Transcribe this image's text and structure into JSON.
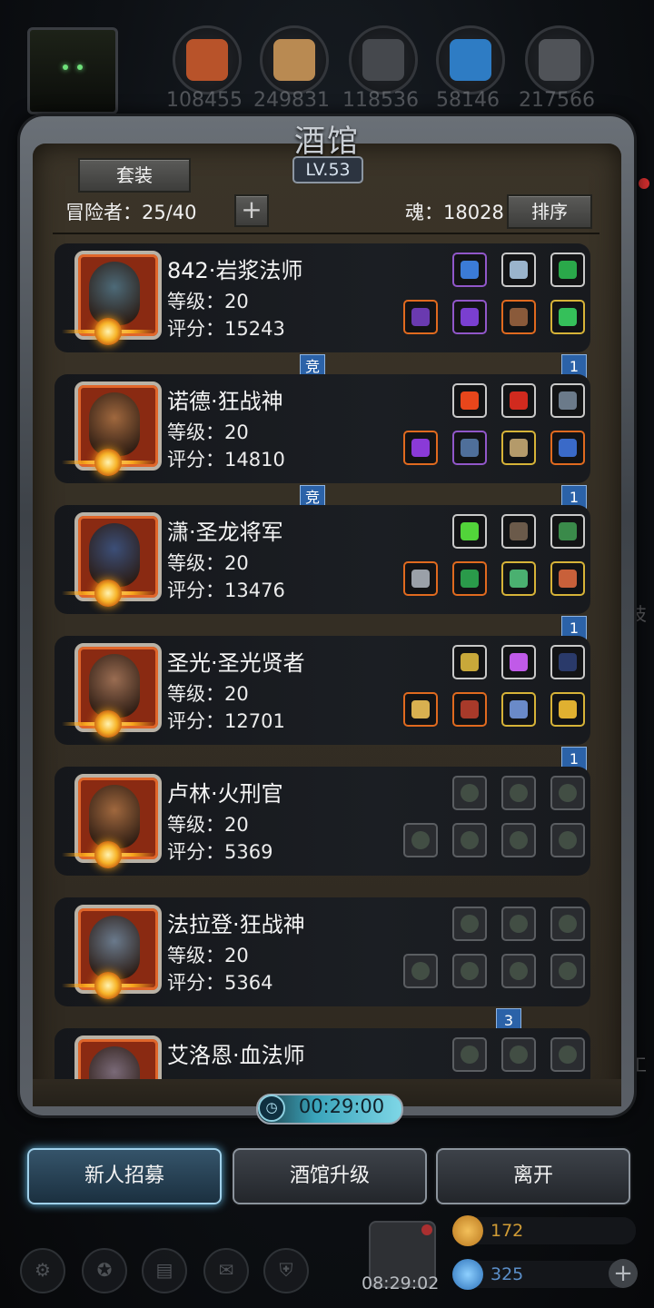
{
  "top": {
    "resources": [
      {
        "name": "meat-icon",
        "value": "108455",
        "color": "#b8532a"
      },
      {
        "name": "wood-icon",
        "value": "249831",
        "color": "#b98a52"
      },
      {
        "name": "iron-icon",
        "value": "118536",
        "color": "#8d9196"
      },
      {
        "name": "crystal-icon",
        "value": "58146",
        "color": "#3f9de0"
      },
      {
        "name": "stone-icon",
        "value": "217566",
        "color": "#6f7378"
      }
    ]
  },
  "tavern": {
    "title": "酒馆",
    "level": "LV.53",
    "set_label": "套装",
    "adventurers": "冒险者：25/40",
    "plus": "+",
    "soul": "魂：18028",
    "sort_label": "排序"
  },
  "heroes": [
    {
      "name": "842·岩浆法师",
      "level": "等级：20",
      "score": "评分：15243",
      "face": "#4d6a78",
      "top_slots": [
        "purple-orb",
        "pendant",
        "green-scroll"
      ],
      "bottom_slots": [
        "staff",
        "purple-armor",
        "tome",
        "green-glove"
      ],
      "tags": {
        "center": "竞",
        "right": "1"
      }
    },
    {
      "name": "诺德·狂战神",
      "level": "等级：20",
      "score": "评分：14810",
      "face": "#a0683e",
      "top_slots": [
        "fire-orb",
        "red-gem",
        "dark-emblem"
      ],
      "bottom_slots": [
        "purple-blade",
        "blue-armor",
        "bone-club",
        "blue-gauntlet"
      ],
      "tags": {
        "center": "竞",
        "right": "1"
      }
    },
    {
      "name": "潇·圣龙将军",
      "level": "等级：20",
      "score": "评分：13476",
      "face": "#3c4f78",
      "top_slots": [
        "green-potion",
        "claw",
        "green-talon"
      ],
      "bottom_slots": [
        "sword",
        "green-armor",
        "ring",
        "heart"
      ],
      "tags": {
        "center": "",
        "right": "1"
      }
    },
    {
      "name": "圣光·圣光贤者",
      "level": "等级：20",
      "score": "评分：12701",
      "face": "#9a6d52",
      "top_slots": [
        "gold-helm",
        "purple-crystal",
        "dark-rune"
      ],
      "bottom_slots": [
        "hammer",
        "red-robe",
        "blue-dagger",
        "gold-ring"
      ],
      "tags": {
        "center": "",
        "right": "1"
      }
    },
    {
      "name": "卢林·火刑官",
      "level": "等级：20",
      "score": "评分：5369",
      "face": "#a0683e",
      "top_slots": [
        "empty",
        "empty",
        "empty"
      ],
      "bottom_slots": [
        "empty",
        "empty",
        "empty",
        "empty"
      ],
      "tags": {
        "center": "",
        "right": ""
      }
    },
    {
      "name": "法拉登·狂战神",
      "level": "等级：20",
      "score": "评分：5364",
      "face": "#6a7a8c",
      "top_slots": [
        "empty",
        "empty",
        "empty"
      ],
      "bottom_slots": [
        "empty",
        "empty",
        "empty",
        "empty"
      ],
      "tags": {
        "center": "3",
        "right": ""
      }
    },
    {
      "name": "艾洛恩·血法师",
      "level": "",
      "score": "",
      "face": "#7a6a78",
      "top_slots": [
        "empty",
        "empty",
        "empty"
      ],
      "bottom_slots": [],
      "tags": {
        "center": "",
        "right": ""
      }
    }
  ],
  "timer": "00:29:00",
  "actions": {
    "recruit": "新人招募",
    "upgrade": "酒馆升级",
    "leave": "离开"
  },
  "bottom": {
    "gift_timer": "08:29:02",
    "gold": "172",
    "gems": "325",
    "plus": "+"
  },
  "side": {
    "label1": "技",
    "label2": "工"
  },
  "colors": {
    "accent": "#9fd0ea",
    "tag_blue": "#2b62a8",
    "frame": "#5a5f66"
  }
}
